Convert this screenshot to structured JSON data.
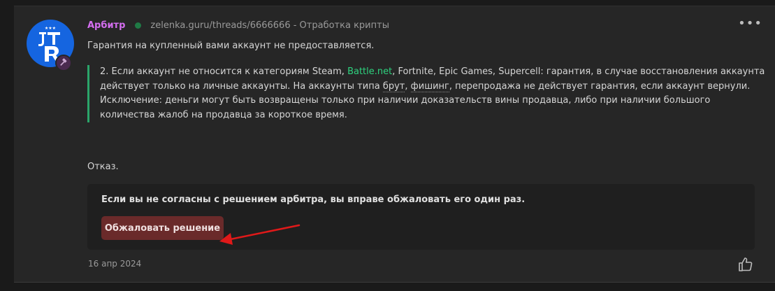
{
  "post": {
    "author": "Арбитр",
    "thread_link": "zelenka.guru/threads/6666666 - Отработка крипты",
    "text_line": "Гарантия на купленный вами аккаунт не предоставляется.",
    "quote": {
      "part1": "2. Если аккаунт не относится к категориям Steam, ",
      "link": "Battle.net",
      "part2": ", Fortnite, Epic Games, Supercell: гарантия, в случае восстановления аккаунта действует только на личные аккаунты. На аккаунты типа ",
      "word_brut": "брут",
      "part3": ", ",
      "word_phishing": "фишинг",
      "part4": ", перепродажа не действует гарантия, если аккаунт вернули. Исключение: деньги могут быть возвращены только при наличии доказательств вины продавца, либо при наличии большого количества жалоб на продавца за короткое время."
    },
    "refusal": "Отказ.",
    "appeal_text": "Если вы не согласны с решением арбитра, вы вправе обжаловать его один раз.",
    "appeal_button": "Обжаловать решение",
    "date": "16 апр 2024",
    "menu_label": "•••"
  },
  "avatar": {
    "icon": "jtr-logo-icon",
    "bg_color": "#1565e0",
    "badge_icon": "gavel-icon"
  },
  "colors": {
    "username": "#d46ef0",
    "link": "#2ed27f",
    "quote_border": "#2ba56a",
    "button_bg": "#6a2a2a",
    "arrow": "#e01919"
  }
}
